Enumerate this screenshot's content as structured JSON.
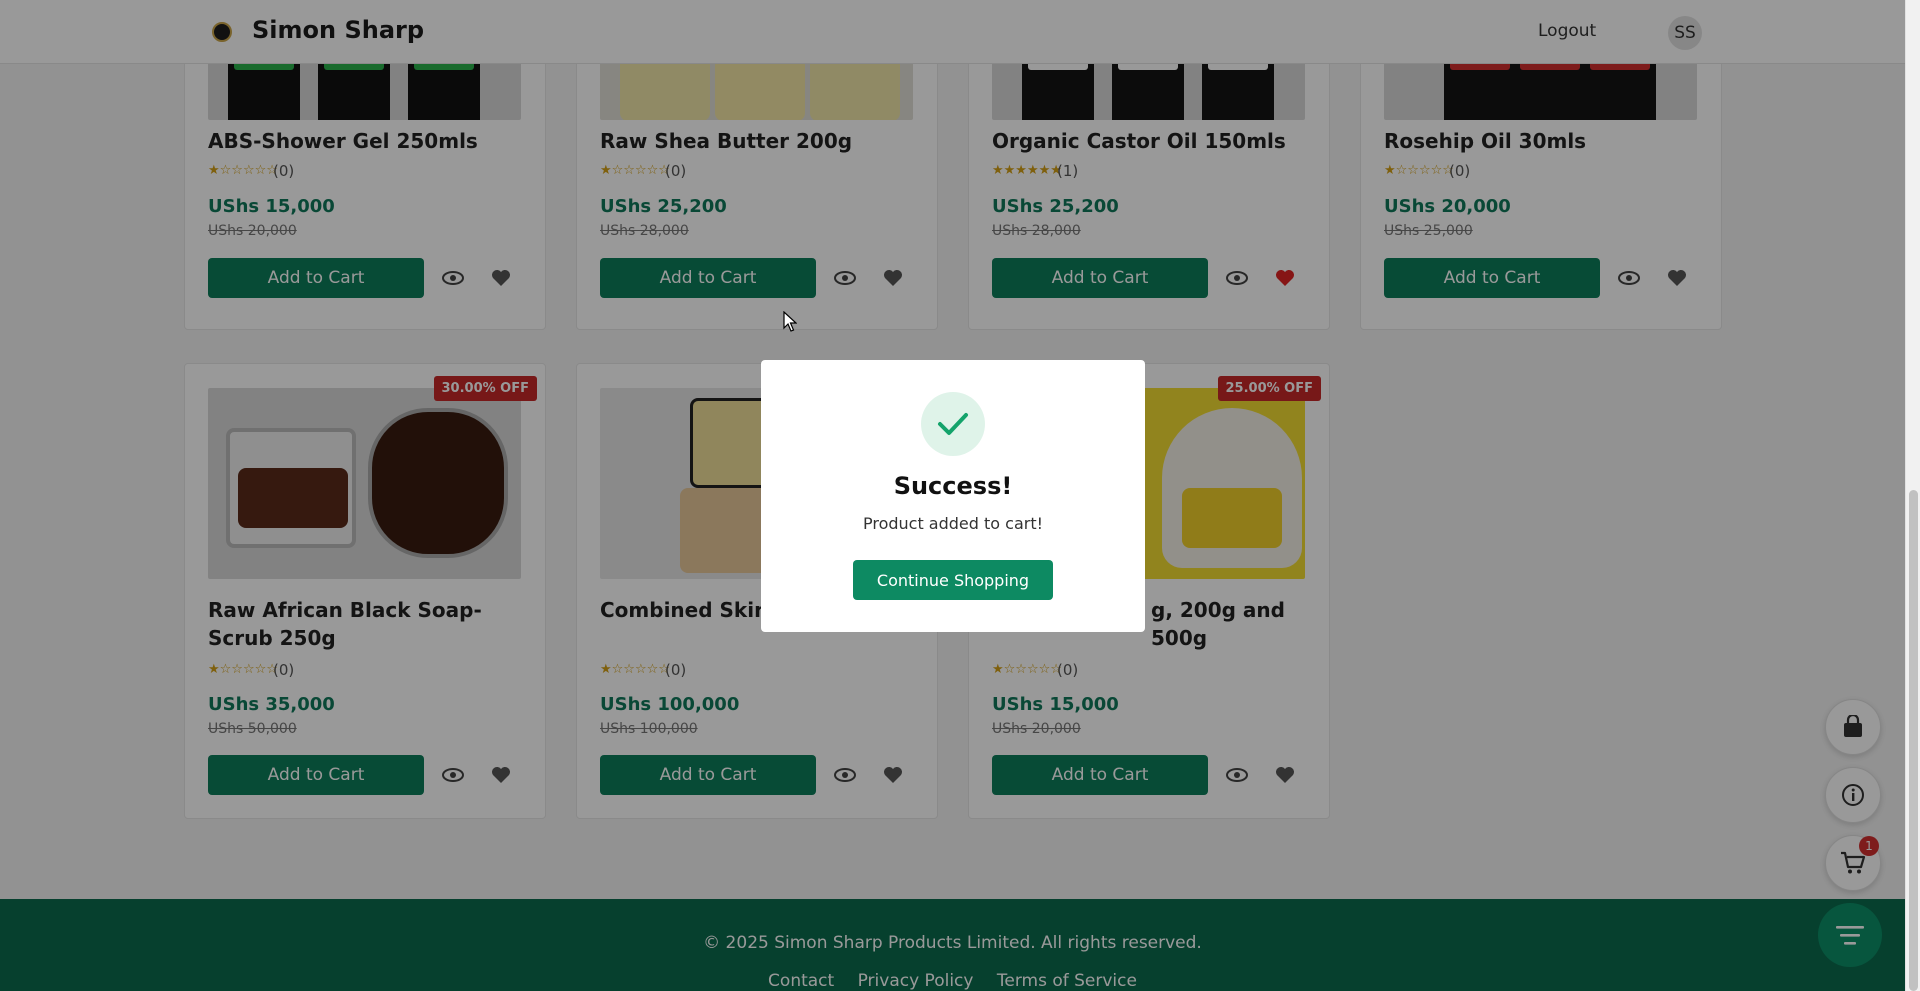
{
  "header": {
    "brand": "Simon Sharp",
    "logout_label": "Logout",
    "avatar_initials": "SS"
  },
  "products": [
    {
      "name": "ABS-Shower Gel 250mls",
      "stars": "★☆☆☆☆☆",
      "rating_count": "(0)",
      "price": "UShs 15,000",
      "old_price": "UShs 20,000",
      "add_label": "Add to Cart",
      "favorited": false
    },
    {
      "name": "Raw Shea Butter 200g",
      "stars": "★☆☆☆☆☆",
      "rating_count": "(0)",
      "price": "UShs 25,200",
      "old_price": "UShs 28,000",
      "add_label": "Add to Cart",
      "favorited": false
    },
    {
      "name": "Organic Castor Oil 150mls",
      "stars": "★★★★★★",
      "rating_count": "(1)",
      "price": "UShs 25,200",
      "old_price": "UShs 28,000",
      "add_label": "Add to Cart",
      "favorited": true
    },
    {
      "name": "Rosehip Oil 30mls",
      "stars": "★☆☆☆☆☆",
      "rating_count": "(0)",
      "price": "UShs 20,000",
      "old_price": "UShs 25,000",
      "add_label": "Add to Cart",
      "favorited": false
    },
    {
      "name": "Raw African Black Soap-Scrub 250g",
      "stars": "★☆☆☆☆☆",
      "rating_count": "(0)",
      "price": "UShs 35,000",
      "old_price": "UShs 50,000",
      "add_label": "Add to Cart",
      "favorited": false,
      "badge": "30.00% OFF"
    },
    {
      "name": "Combined Skin",
      "stars": "★☆☆☆☆☆",
      "rating_count": "(0)",
      "price": "UShs 100,000",
      "old_price": "UShs 100,000",
      "add_label": "Add to Cart",
      "favorited": false
    },
    {
      "name": "g, 200g and 500g",
      "stars": "★☆☆☆☆☆",
      "rating_count": "(0)",
      "price": "UShs 15,000",
      "old_price": "UShs 20,000",
      "add_label": "Add to Cart",
      "favorited": false,
      "badge": "25.00% OFF"
    }
  ],
  "footer": {
    "copyright": "© 2025 Simon Sharp Products Limited. All rights reserved.",
    "links": [
      "Contact",
      "Privacy Policy",
      "Terms of Service"
    ]
  },
  "floating": {
    "cart_count": "1"
  },
  "modal": {
    "title": "Success!",
    "message": "Product added to cart!",
    "button_label": "Continue Shopping"
  },
  "colors": {
    "primary_green": "#0d7d5a",
    "footer_green": "#0b6b4e",
    "sale_red": "#c62828",
    "favorite_red": "#d32f2f"
  }
}
